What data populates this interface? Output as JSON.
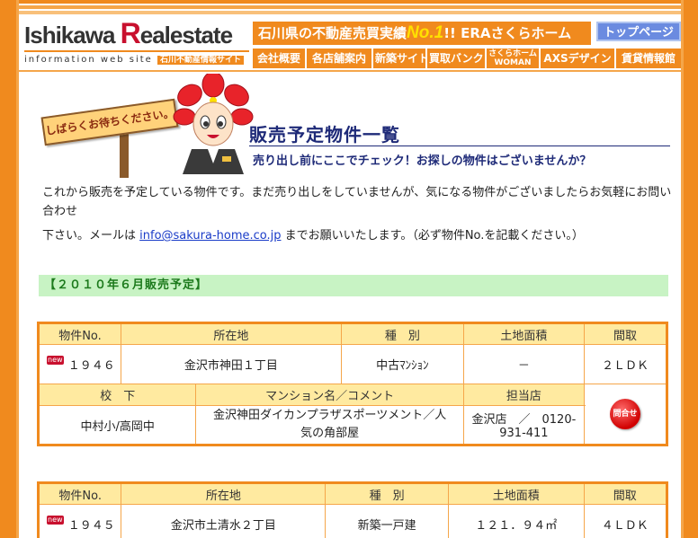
{
  "logo": {
    "part1_letter": "I",
    "part1_rest": "shikawa ",
    "part2_letter": "R",
    "part2_rest": "ealestate",
    "tagline": "information web site",
    "tagline_jp": "石川不動産情報サイト"
  },
  "banner": {
    "pre": "石川県の不動産売買実績",
    "no1": "No.1",
    "post": "!! ERAさくらホーム"
  },
  "top_button": "トップページ",
  "nav": [
    {
      "label": "会社概要"
    },
    {
      "label": "各店舗案内"
    },
    {
      "label": "新築サイト"
    },
    {
      "label": "買取バンク"
    },
    {
      "label": "さくらホーム",
      "label2": "WOMAN"
    },
    {
      "label": "AXSデザイン"
    },
    {
      "label": "賃貸情報館"
    }
  ],
  "sign_text": "しばらくお待ちください。",
  "page": {
    "title": "販売予定物件一覧",
    "subtitle": "売り出し前にここでチェック！お探しの物件はございませんか？",
    "intro1": "これから販売を予定している物件です。まだ売り出しをしていませんが、気になる物件がございましたらお気軽にお問い合わせ",
    "intro2_pre": "下さい。メールは ",
    "email": "info@sakura-home.co.jp",
    "intro2_post": " までお願いいたします。（必ず物件No.を記載ください。）",
    "section": "【２０１０年６月販売予定】"
  },
  "table_headers": {
    "row1": [
      "物件No.",
      "所在地",
      "種　別",
      "土地面積",
      "間取"
    ],
    "row2": [
      "校　下",
      "マンション名／コメント",
      "担当店"
    ]
  },
  "new_label": "new",
  "inquiry_label": "問合せ",
  "properties": [
    {
      "no": "１９４６",
      "location": "金沢市神田１丁目",
      "type": "中古ﾏﾝｼｮﾝ",
      "land": "－",
      "layout": "２ＬＤＫ",
      "school": "中村小/高岡中",
      "comment": "金沢神田ダイカンプラザスポーツメント／人気の角部屋",
      "office": "金沢店　／　0120-931-411"
    },
    {
      "no": "１９４５",
      "location": "金沢市土清水２丁目",
      "type": "新築一戸建",
      "land": "１２１．９４㎡",
      "layout": "４ＬＤＫ"
    }
  ],
  "colors": {
    "accent": "#f08a1e",
    "header_cell": "#ffeaa0",
    "section_bg": "#c8f3c4",
    "title": "#1e2a78"
  }
}
